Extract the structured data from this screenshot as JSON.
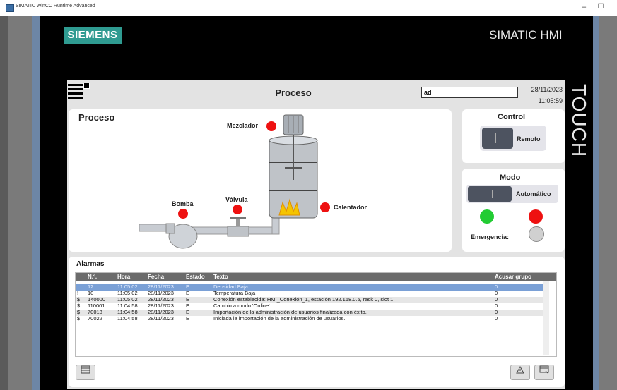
{
  "window": {
    "title": "SIMATIC WinCC Runtime Advanced",
    "minimize": "–",
    "maximize": "☐"
  },
  "brand": {
    "logo": "SIEMENS",
    "product": "SIMATIC HMI",
    "side": "TOUCH"
  },
  "header": {
    "title": "Proceso",
    "user_field": "ad",
    "date": "28/11/2023",
    "time": "11:05:59"
  },
  "process": {
    "title": "Proceso",
    "labels": {
      "mixer": "Mezclador",
      "pump": "Bomba",
      "valve": "Válvula",
      "heater": "Calentador"
    }
  },
  "control": {
    "title": "Control",
    "switch_label": "Remoto"
  },
  "mode": {
    "title": "Modo",
    "switch_label": "Automático",
    "emergency_label": "Emergencia:"
  },
  "alarms": {
    "title": "Alarmas",
    "columns": [
      "N.º.",
      "Hora",
      "Fecha",
      "Estado",
      "Texto",
      "Acusar grupo"
    ],
    "rows": [
      {
        "flag": "",
        "num": "12",
        "time": "11:05:02",
        "date": "28/11/2023",
        "state": "E",
        "text": "Densidad Baja",
        "group": "0"
      },
      {
        "flag": "!",
        "num": "10",
        "time": "11:05:02",
        "date": "28/11/2023",
        "state": "E",
        "text": "Temperatura Baja",
        "group": "0"
      },
      {
        "flag": "$",
        "num": "140000",
        "time": "11:05:02",
        "date": "28/11/2023",
        "state": "E",
        "text": "Conexión establecida: HMI_Conexión_1, estación 192.168.0.5, rack 0, slot 1.",
        "group": "0"
      },
      {
        "flag": "$",
        "num": "110001",
        "time": "11:04:58",
        "date": "28/11/2023",
        "state": "E",
        "text": "Cambio a modo 'Online'.",
        "group": "0"
      },
      {
        "flag": "$",
        "num": "70018",
        "time": "11:04:58",
        "date": "28/11/2023",
        "state": "E",
        "text": "Importación de la administración de usuarios finalizada con éxito.",
        "group": "0"
      },
      {
        "flag": "$",
        "num": "70022",
        "time": "11:04:58",
        "date": "28/11/2023",
        "state": "E",
        "text": "Iniciada la importación de la administración de usuarios.",
        "group": "0"
      }
    ]
  },
  "colors": {
    "accent": "#2f9b91",
    "alarm_red": "#e11111",
    "ok_green": "#22cc33",
    "selected_row": "#7aa0d6"
  }
}
